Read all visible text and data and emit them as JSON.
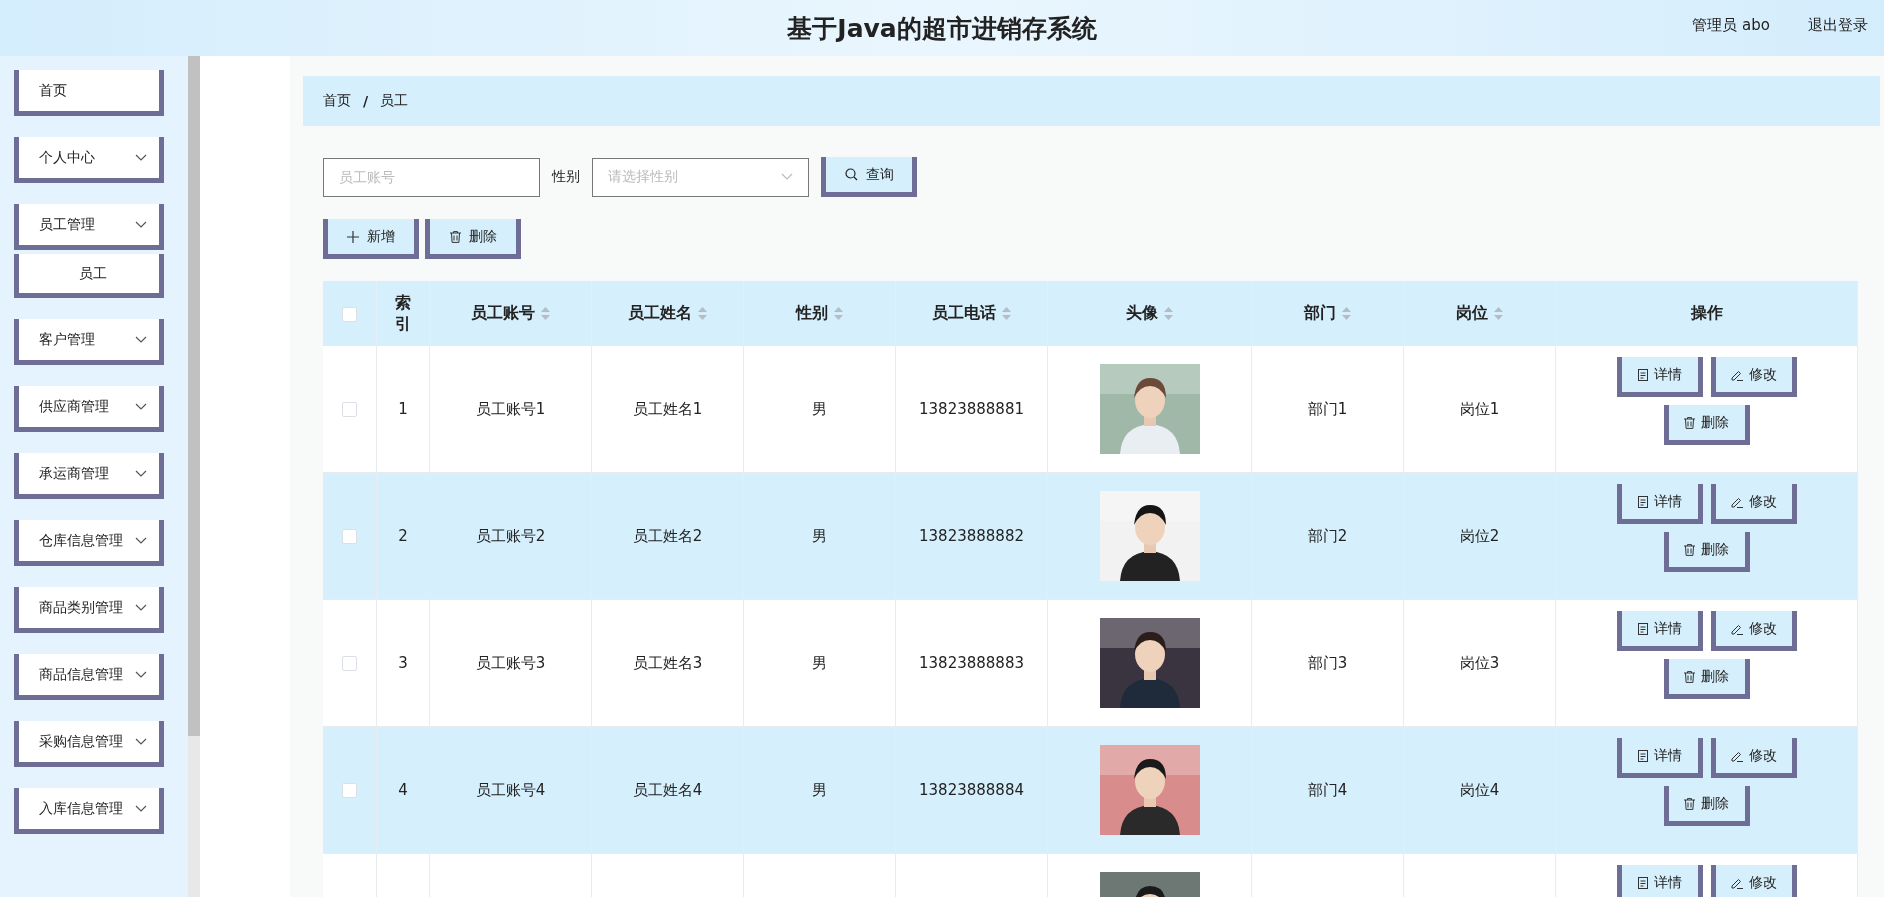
{
  "header": {
    "title": "基于Java的超市进销存系统",
    "user": "管理员 abo",
    "logout": "退出登录"
  },
  "sidebar": {
    "items": [
      {
        "label": "首页",
        "has_children": false
      },
      {
        "label": "个人中心",
        "has_children": true
      },
      {
        "label": "员工管理",
        "has_children": true,
        "children": [
          {
            "label": "员工"
          }
        ]
      },
      {
        "label": "客户管理",
        "has_children": true
      },
      {
        "label": "供应商管理",
        "has_children": true
      },
      {
        "label": "承运商管理",
        "has_children": true
      },
      {
        "label": "仓库信息管理",
        "has_children": true
      },
      {
        "label": "商品类别管理",
        "has_children": true
      },
      {
        "label": "商品信息管理",
        "has_children": true
      },
      {
        "label": "采购信息管理",
        "has_children": true
      },
      {
        "label": "入库信息管理",
        "has_children": true
      }
    ]
  },
  "breadcrumb": {
    "items": [
      "首页",
      "员工"
    ],
    "separator": "/"
  },
  "search": {
    "account_placeholder": "员工账号",
    "gender_label": "性别",
    "gender_placeholder": "请选择性别",
    "query_button": "查询"
  },
  "toolbar": {
    "add": "新增",
    "delete": "删除"
  },
  "table": {
    "header_checked": false,
    "columns": [
      {
        "label": "索引",
        "sortable": false
      },
      {
        "label": "员工账号",
        "sortable": true
      },
      {
        "label": "员工姓名",
        "sortable": true
      },
      {
        "label": "性别",
        "sortable": true
      },
      {
        "label": "员工电话",
        "sortable": true
      },
      {
        "label": "头像",
        "sortable": true
      },
      {
        "label": "部门",
        "sortable": true
      },
      {
        "label": "岗位",
        "sortable": true
      },
      {
        "label": "操作",
        "sortable": false
      }
    ],
    "rows": [
      {
        "checked": false,
        "index": "1",
        "account": "员工账号1",
        "name": "员工姓名1",
        "gender": "男",
        "phone": "13823888881",
        "avatar": {
          "kind": "picture"
        },
        "dept": "部门1",
        "post": "岗位1",
        "actions": [
          "详情",
          "修改",
          "删除"
        ]
      },
      {
        "checked": false,
        "index": "2",
        "account": "员工账号2",
        "name": "员工姓名2",
        "gender": "男",
        "phone": "13823888882",
        "avatar": {
          "kind": "picture"
        },
        "dept": "部门2",
        "post": "岗位2",
        "actions": [
          "详情",
          "修改",
          "删除"
        ]
      },
      {
        "checked": false,
        "index": "3",
        "account": "员工账号3",
        "name": "员工姓名3",
        "gender": "男",
        "phone": "13823888883",
        "avatar": {
          "kind": "picture"
        },
        "dept": "部门3",
        "post": "岗位3",
        "actions": [
          "详情",
          "修改",
          "删除"
        ]
      },
      {
        "checked": false,
        "index": "4",
        "account": "员工账号4",
        "name": "员工姓名4",
        "gender": "男",
        "phone": "13823888884",
        "avatar": {
          "kind": "picture"
        },
        "dept": "部门4",
        "post": "岗位4",
        "actions": [
          "详情",
          "修改",
          "删除"
        ]
      },
      {
        "avatar": {
          "kind": "picture"
        },
        "actions": [
          "详情",
          "修改"
        ]
      }
    ]
  }
}
